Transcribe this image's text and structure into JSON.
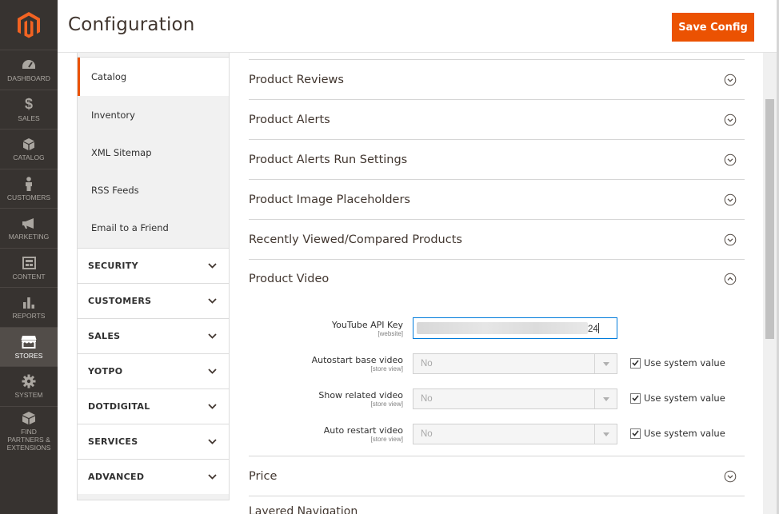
{
  "header": {
    "title": "Configuration",
    "save_label": "Save Config"
  },
  "admin_menu": [
    {
      "label": "DASHBOARD",
      "icon": "dashboard-icon"
    },
    {
      "label": "SALES",
      "icon": "dollar-icon"
    },
    {
      "label": "CATALOG",
      "icon": "cube-icon"
    },
    {
      "label": "CUSTOMERS",
      "icon": "person-icon"
    },
    {
      "label": "MARKETING",
      "icon": "megaphone-icon"
    },
    {
      "label": "CONTENT",
      "icon": "layout-icon"
    },
    {
      "label": "REPORTS",
      "icon": "bar-chart-icon"
    },
    {
      "label": "STORES",
      "icon": "store-icon",
      "active": true
    },
    {
      "label": "SYSTEM",
      "icon": "gear-icon"
    },
    {
      "label": "FIND PARTNERS & EXTENSIONS",
      "icon": "extensions-icon"
    }
  ],
  "config_tabs": {
    "catalog_items": [
      "Catalog",
      "Inventory",
      "XML Sitemap",
      "RSS Feeds",
      "Email to a Friend"
    ],
    "active_item": "Catalog",
    "groups": [
      "SECURITY",
      "CUSTOMERS",
      "SALES",
      "YOTPO",
      "DOTDIGITAL",
      "SERVICES",
      "ADVANCED"
    ]
  },
  "sections": {
    "collapsed_top": [
      "Product Reviews",
      "Product Alerts",
      "Product Alerts Run Settings",
      "Product Image Placeholders",
      "Recently Viewed/Compared Products"
    ],
    "open": "Product Video",
    "after": "Price",
    "cut_off": "Layered Navigation"
  },
  "product_video": {
    "api_key": {
      "label": "YouTube API Key",
      "scope": "[website]",
      "value_suffix": "24"
    },
    "autostart": {
      "label": "Autostart base video",
      "scope": "[store view]",
      "value": "No",
      "use_system": "Use system value"
    },
    "show_related": {
      "label": "Show related video",
      "scope": "[store view]",
      "value": "No",
      "use_system": "Use system value"
    },
    "auto_restart": {
      "label": "Auto restart video",
      "scope": "[store view]",
      "value": "No",
      "use_system": "Use system value"
    }
  },
  "colors": {
    "accent": "#eb5202",
    "menu_bg": "#373330",
    "focus": "#007bdb"
  }
}
